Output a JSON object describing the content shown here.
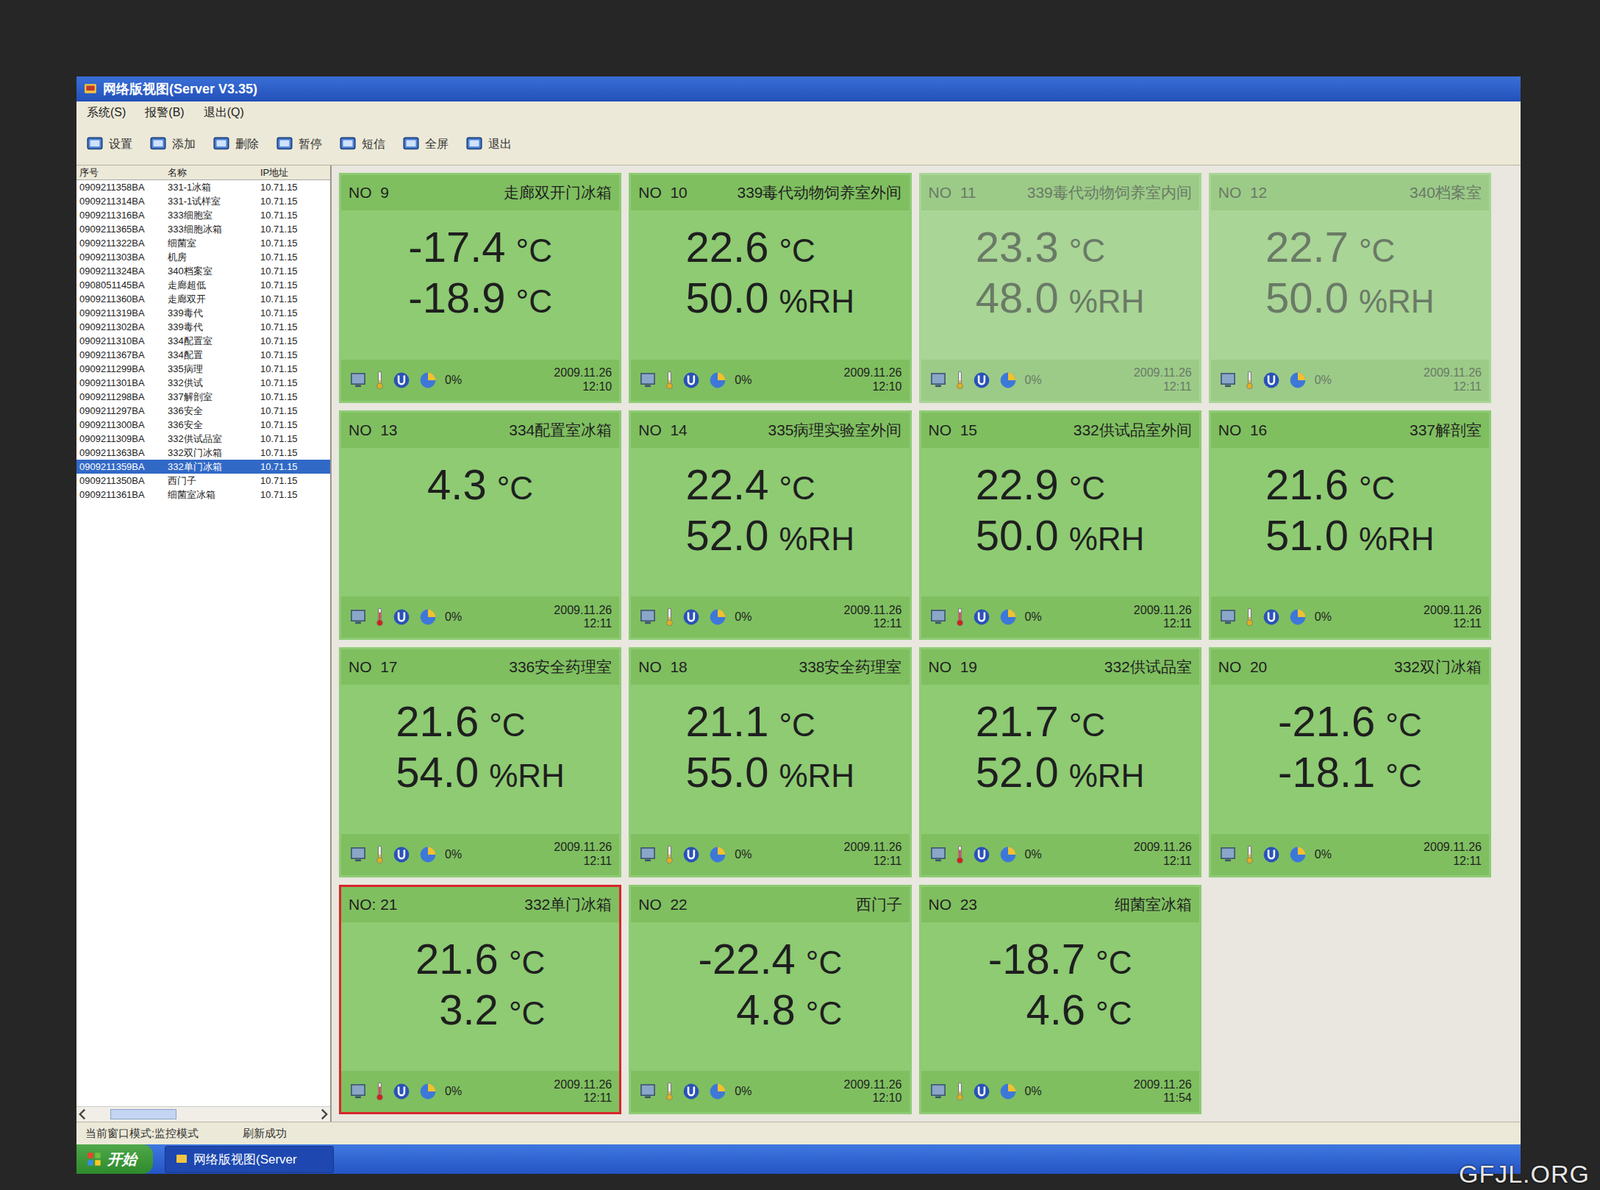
{
  "window": {
    "title": "网络版视图(Server V3.35)"
  },
  "menu": [
    "系统(S)",
    "报警(B)",
    "退出(Q)"
  ],
  "toolbar": [
    {
      "label": "设置"
    },
    {
      "label": "添加"
    },
    {
      "label": "删除"
    },
    {
      "label": "暂停"
    },
    {
      "label": "短信"
    },
    {
      "label": "全屏"
    },
    {
      "label": "退出"
    }
  ],
  "device_list": {
    "columns": [
      "序号",
      "名称",
      "IP地址"
    ],
    "rows": [
      {
        "id": "0909211358BA",
        "name": "331-1冰箱",
        "ip": "10.71.15",
        "selected": false
      },
      {
        "id": "0909211314BA",
        "name": "331-1试样室",
        "ip": "10.71.15",
        "selected": false
      },
      {
        "id": "0909211316BA",
        "name": "333细胞室",
        "ip": "10.71.15",
        "selected": false
      },
      {
        "id": "0909211365BA",
        "name": "333细胞冰箱",
        "ip": "10.71.15",
        "selected": false
      },
      {
        "id": "0909211322BA",
        "name": "细菌室",
        "ip": "10.71.15",
        "selected": false
      },
      {
        "id": "0909211303BA",
        "name": "机房",
        "ip": "10.71.15",
        "selected": false
      },
      {
        "id": "0909211324BA",
        "name": "340档案室",
        "ip": "10.71.15",
        "selected": false
      },
      {
        "id": "0908051145BA",
        "name": "走廊超低",
        "ip": "10.71.15",
        "selected": false
      },
      {
        "id": "0909211360BA",
        "name": "走廊双开",
        "ip": "10.71.15",
        "selected": false
      },
      {
        "id": "0909211319BA",
        "name": "339毒代",
        "ip": "10.71.15",
        "selected": false
      },
      {
        "id": "0909211302BA",
        "name": "339毒代",
        "ip": "10.71.15",
        "selected": false
      },
      {
        "id": "0909211310BA",
        "name": "334配置室",
        "ip": "10.71.15",
        "selected": false
      },
      {
        "id": "0909211367BA",
        "name": "334配置",
        "ip": "10.71.15",
        "selected": false
      },
      {
        "id": "0909211299BA",
        "name": "335病理",
        "ip": "10.71.15",
        "selected": false
      },
      {
        "id": "0909211301BA",
        "name": "332供试",
        "ip": "10.71.15",
        "selected": false
      },
      {
        "id": "0909211298BA",
        "name": "337解剖室",
        "ip": "10.71.15",
        "selected": false
      },
      {
        "id": "0909211297BA",
        "name": "336安全",
        "ip": "10.71.15",
        "selected": false
      },
      {
        "id": "0909211300BA",
        "name": "336安全",
        "ip": "10.71.15",
        "selected": false
      },
      {
        "id": "0909211309BA",
        "name": "332供试品室",
        "ip": "10.71.15",
        "selected": false
      },
      {
        "id": "0909211363BA",
        "name": "332双门冰箱",
        "ip": "10.71.15",
        "selected": false
      },
      {
        "id": "0909211359BA",
        "name": "332单门冰箱",
        "ip": "10.71.15",
        "selected": true
      },
      {
        "id": "0909211350BA",
        "name": "西门子",
        "ip": "10.71.15",
        "selected": false
      },
      {
        "id": "0909211361BA",
        "name": "细菌室冰箱",
        "ip": "10.71.15",
        "selected": false
      }
    ]
  },
  "cards": [
    {
      "no": "NO  9",
      "name": "走廊双开门冰箱",
      "readings": [
        {
          "value": "-17.4",
          "unit": "°C"
        },
        {
          "value": "-18.9",
          "unit": "°C"
        }
      ],
      "alarm": false,
      "dimmed": false,
      "selected": false,
      "battery": "0%",
      "date": "2009.11.26",
      "time": "12:10"
    },
    {
      "no": "NO  10",
      "name": "339毒代动物饲养室外间",
      "readings": [
        {
          "value": "22.6",
          "unit": "°C"
        },
        {
          "value": "50.0",
          "unit": "%RH"
        }
      ],
      "alarm": false,
      "dimmed": false,
      "selected": false,
      "battery": "0%",
      "date": "2009.11.26",
      "time": "12:10"
    },
    {
      "no": "NO  11",
      "name": "339毒代动物饲养室内间",
      "readings": [
        {
          "value": "23.3",
          "unit": "°C"
        },
        {
          "value": "48.0",
          "unit": "%RH"
        }
      ],
      "alarm": false,
      "dimmed": true,
      "selected": false,
      "battery": "0%",
      "date": "2009.11.26",
      "time": "12:11"
    },
    {
      "no": "NO  12",
      "name": "340档案室",
      "readings": [
        {
          "value": "22.7",
          "unit": "°C"
        },
        {
          "value": "50.0",
          "unit": "%RH"
        }
      ],
      "alarm": false,
      "dimmed": true,
      "selected": false,
      "battery": "0%",
      "date": "2009.11.26",
      "time": "12:11"
    },
    {
      "no": "NO  13",
      "name": "334配置室冰箱",
      "readings": [
        {
          "value": "4.3",
          "unit": "°C"
        }
      ],
      "alarm": true,
      "dimmed": false,
      "selected": false,
      "battery": "0%",
      "date": "2009.11.26",
      "time": "12:11"
    },
    {
      "no": "NO  14",
      "name": "335病理实验室外间",
      "readings": [
        {
          "value": "22.4",
          "unit": "°C"
        },
        {
          "value": "52.0",
          "unit": "%RH"
        }
      ],
      "alarm": false,
      "dimmed": false,
      "selected": false,
      "battery": "0%",
      "date": "2009.11.26",
      "time": "12:11"
    },
    {
      "no": "NO  15",
      "name": "332供试品室外间",
      "readings": [
        {
          "value": "22.9",
          "unit": "°C"
        },
        {
          "value": "50.0",
          "unit": "%RH"
        }
      ],
      "alarm": true,
      "dimmed": false,
      "selected": false,
      "battery": "0%",
      "date": "2009.11.26",
      "time": "12:11"
    },
    {
      "no": "NO  16",
      "name": "337解剖室",
      "readings": [
        {
          "value": "21.6",
          "unit": "°C"
        },
        {
          "value": "51.0",
          "unit": "%RH"
        }
      ],
      "alarm": false,
      "dimmed": false,
      "selected": false,
      "battery": "0%",
      "date": "2009.11.26",
      "time": "12:11"
    },
    {
      "no": "NO  17",
      "name": "336安全药理室",
      "readings": [
        {
          "value": "21.6",
          "unit": "°C"
        },
        {
          "value": "54.0",
          "unit": "%RH"
        }
      ],
      "alarm": false,
      "dimmed": false,
      "selected": false,
      "battery": "0%",
      "date": "2009.11.26",
      "time": "12:11"
    },
    {
      "no": "NO  18",
      "name": "338安全药理室",
      "readings": [
        {
          "value": "21.1",
          "unit": "°C"
        },
        {
          "value": "55.0",
          "unit": "%RH"
        }
      ],
      "alarm": false,
      "dimmed": false,
      "selected": false,
      "battery": "0%",
      "date": "2009.11.26",
      "time": "12:11"
    },
    {
      "no": "NO  19",
      "name": "332供试品室",
      "readings": [
        {
          "value": "21.7",
          "unit": "°C"
        },
        {
          "value": "52.0",
          "unit": "%RH"
        }
      ],
      "alarm": true,
      "dimmed": false,
      "selected": false,
      "battery": "0%",
      "date": "2009.11.26",
      "time": "12:11"
    },
    {
      "no": "NO  20",
      "name": "332双门冰箱",
      "readings": [
        {
          "value": "-21.6",
          "unit": "°C"
        },
        {
          "value": "-18.1",
          "unit": "°C"
        }
      ],
      "alarm": false,
      "dimmed": false,
      "selected": false,
      "battery": "0%",
      "date": "2009.11.26",
      "time": "12:11"
    },
    {
      "no": "NO: 21",
      "name": "332单门冰箱",
      "readings": [
        {
          "value": "21.6",
          "unit": "°C"
        },
        {
          "value": "3.2",
          "unit": "°C"
        }
      ],
      "alarm": true,
      "dimmed": false,
      "selected": true,
      "battery": "0%",
      "date": "2009.11.26",
      "time": "12:11"
    },
    {
      "no": "NO  22",
      "name": "西门子",
      "readings": [
        {
          "value": "-22.4",
          "unit": "°C"
        },
        {
          "value": "4.8",
          "unit": "°C"
        }
      ],
      "alarm": false,
      "dimmed": false,
      "selected": false,
      "battery": "0%",
      "date": "2009.11.26",
      "time": "12:10"
    },
    {
      "no": "NO  23",
      "name": "细菌室冰箱",
      "readings": [
        {
          "value": "-18.7",
          "unit": "°C"
        },
        {
          "value": "4.6",
          "unit": "°C"
        }
      ],
      "alarm": false,
      "dimmed": false,
      "selected": false,
      "battery": "0%",
      "date": "2009.11.26",
      "time": "11:54"
    }
  ],
  "status_bar": [
    "当前窗口模式:监控模式",
    "刷新成功"
  ],
  "taskbar": {
    "start": "开始",
    "tasks": [
      "网络版视图(Server"
    ]
  },
  "watermark": "GFJL.ORG"
}
